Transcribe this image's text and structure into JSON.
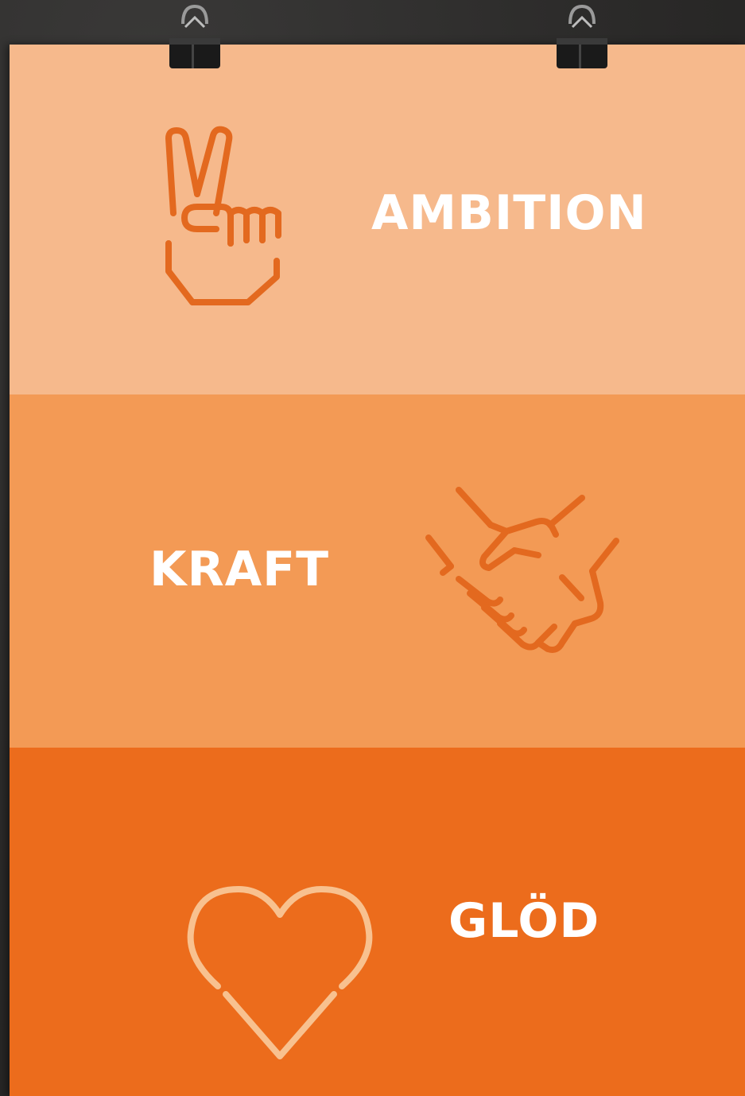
{
  "colors": {
    "background": "#2b2a29",
    "band_light": "#f6b98c",
    "band_medium": "#f39a55",
    "band_dark": "#ec6c1c",
    "text": "#ffffff",
    "icon_orange": "#e3691f",
    "icon_light": "#f8c18f"
  },
  "icons": {
    "clip": "binder-clip-icon",
    "peace": "peace-hand-icon",
    "handshake": "handshake-icon",
    "heart": "heart-icon"
  },
  "values": [
    {
      "word": "AMBITION"
    },
    {
      "word": "KRAFT"
    },
    {
      "word": "GLÖD"
    }
  ]
}
